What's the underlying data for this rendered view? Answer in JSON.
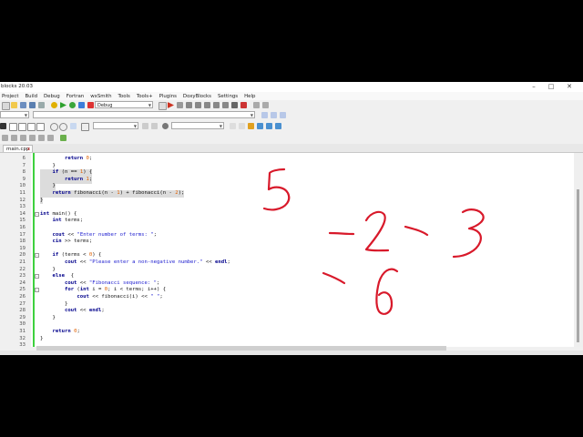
{
  "window": {
    "title": "blocks 20.03",
    "minimize": "–",
    "maximize": "□",
    "close": "✕"
  },
  "menu": [
    "Project",
    "Build",
    "Debug",
    "Fortran",
    "wxSmith",
    "Tools",
    "Tools+",
    "Plugins",
    "DoxyBlocks",
    "Settings",
    "Help"
  ],
  "toolbar": {
    "build_target": "Debug"
  },
  "tab": {
    "label": "main.cpp",
    "close": "x"
  },
  "code_lines": [
    {
      "n": "6",
      "html": "        <span class=\"kw\">return</span> <span class=\"num\">0</span>;"
    },
    {
      "n": "7",
      "html": "    }"
    },
    {
      "n": "8",
      "html": "    <span class=\"kw\">if</span> (n == <span class=\"num\">1</span>) {",
      "sel": true
    },
    {
      "n": "9",
      "html": "        <span class=\"kw\">return</span> <span class=\"num\">1</span>;",
      "sel": true
    },
    {
      "n": "10",
      "html": "    }",
      "sel": true
    },
    {
      "n": "11",
      "html": "    <span class=\"kw\">return</span> fibonacci(n - <span class=\"num\">1</span>) + fibonacci(n - <span class=\"num\">2</span>);",
      "sel": true
    },
    {
      "n": "12",
      "html": "}",
      "sel": true
    },
    {
      "n": "13",
      "html": ""
    },
    {
      "n": "14",
      "html": "<span class=\"kw\">int</span> main() {",
      "fold": "-"
    },
    {
      "n": "15",
      "html": "    <span class=\"kw\">int</span> terms;"
    },
    {
      "n": "16",
      "html": ""
    },
    {
      "n": "17",
      "html": "    <span class=\"kw\">cout</span> &lt;&lt; <span class=\"str\">\"Enter number of terms: \"</span>;"
    },
    {
      "n": "18",
      "html": "    <span class=\"kw\">cin</span> &gt;&gt; terms;"
    },
    {
      "n": "19",
      "html": ""
    },
    {
      "n": "20",
      "html": "    <span class=\"kw\">if</span> (terms &lt; <span class=\"num\">0</span>) {",
      "fold": "-"
    },
    {
      "n": "21",
      "html": "        <span class=\"kw\">cout</span> &lt;&lt; <span class=\"str\">\"Please enter a non-negative number.\"</span> &lt;&lt; <span class=\"kw\">endl</span>;"
    },
    {
      "n": "22",
      "html": "    }"
    },
    {
      "n": "23",
      "html": "    <span class=\"kw\">else</span>  {",
      "fold": "-"
    },
    {
      "n": "24",
      "html": "        <span class=\"kw\">cout</span> &lt;&lt; <span class=\"str\">\"Fibonacci sequence: \"</span>;"
    },
    {
      "n": "25",
      "html": "        <span class=\"kw\">for</span> (<span class=\"kw\">int</span> i = <span class=\"num\">0</span>; i &lt; terms; i++) {",
      "fold": "-"
    },
    {
      "n": "26",
      "html": "            <span class=\"kw\">cout</span> &lt;&lt; fibonacci(i) &lt;&lt; <span class=\"str\">\" \"</span>;"
    },
    {
      "n": "27",
      "html": "        }"
    },
    {
      "n": "28",
      "html": "        <span class=\"kw\">cout</span> &lt;&lt; <span class=\"kw\">endl</span>;"
    },
    {
      "n": "29",
      "html": "    }"
    },
    {
      "n": "30",
      "html": ""
    },
    {
      "n": "31",
      "html": "    <span class=\"kw\">return</span> <span class=\"num\">0</span>;"
    },
    {
      "n": "32",
      "html": "}"
    },
    {
      "n": "33",
      "html": ""
    }
  ],
  "colors": {
    "handwriting": "#d8192a",
    "fold_bar": "#3ed13e",
    "keyword": "#00008b",
    "string": "#1c1ccf",
    "number": "#e06000"
  },
  "handwritten_numbers": [
    "5",
    "-2",
    "-3",
    "-6"
  ]
}
